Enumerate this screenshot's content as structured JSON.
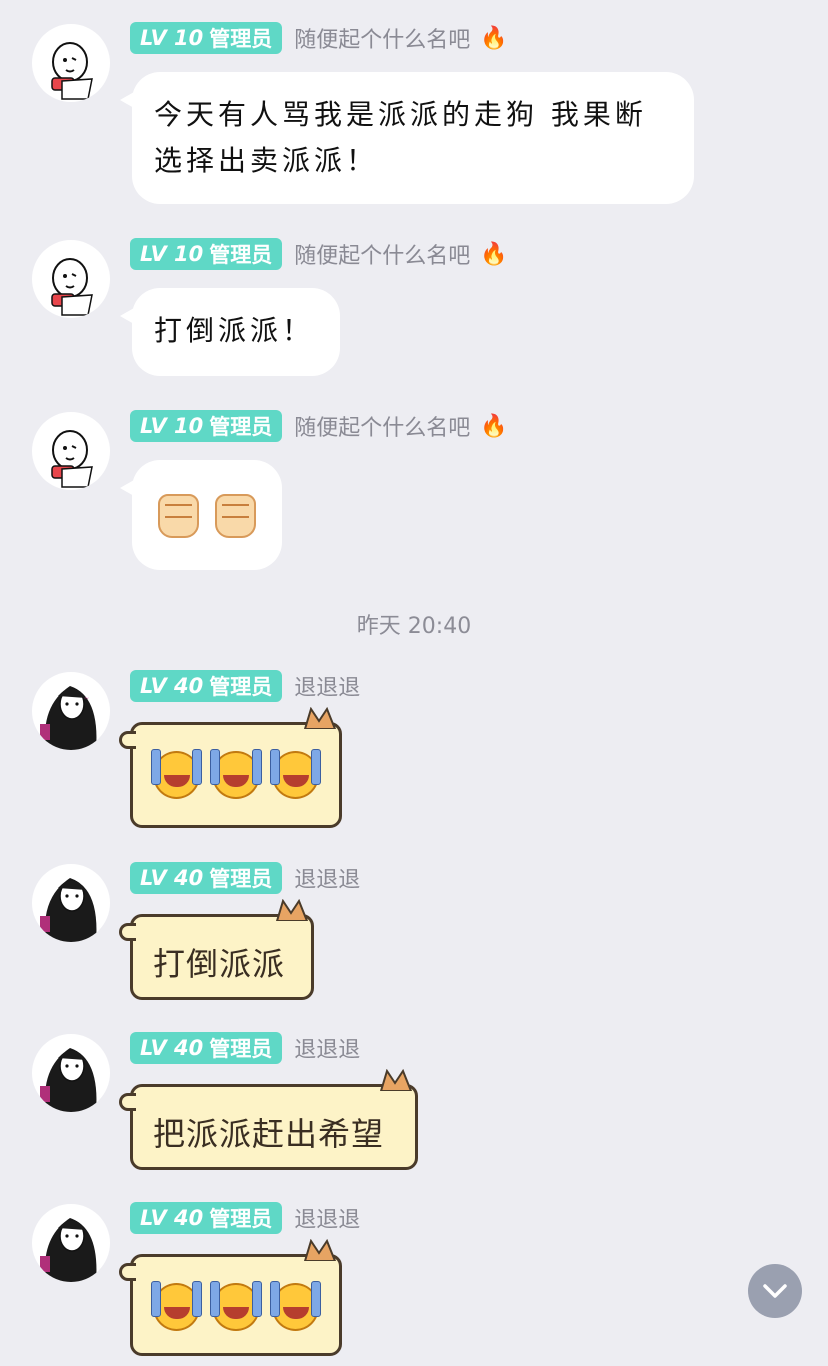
{
  "messages": [
    {
      "level": "LV 10",
      "role": "管理员",
      "nickname": "随便起个什么名吧",
      "fire_icon": "fire-icon",
      "text_line1": "今天有人骂我是派派的走狗 我果断",
      "text_line2": "选择出卖派派！"
    },
    {
      "level": "LV 10",
      "role": "管理员",
      "nickname": "随便起个什么名吧",
      "fire_icon": "fire-icon",
      "text": "打倒派派！"
    },
    {
      "level": "LV 10",
      "role": "管理员",
      "nickname": "随便起个什么名吧",
      "fire_icon": "fire-icon",
      "emoji": [
        "fist-emoji",
        "fist-emoji"
      ]
    },
    {
      "level": "LV 40",
      "role": "管理员",
      "nickname": "退退退",
      "emoji": [
        "laughing-crying-emoji",
        "laughing-crying-emoji",
        "laughing-crying-emoji"
      ]
    },
    {
      "level": "LV 40",
      "role": "管理员",
      "nickname": "退退退",
      "text": "打倒派派"
    },
    {
      "level": "LV 40",
      "role": "管理员",
      "nickname": "退退退",
      "text": "把派派赶出希望"
    },
    {
      "level": "LV 40",
      "role": "管理员",
      "nickname": "退退退",
      "emoji": [
        "laughing-crying-emoji",
        "laughing-crying-emoji",
        "laughing-crying-emoji"
      ]
    }
  ],
  "timestamp": "昨天 20:40",
  "colors": {
    "background": "#ededf2",
    "badge": "#5fd8c6",
    "cat_bubble": "#fdf3c7"
  }
}
